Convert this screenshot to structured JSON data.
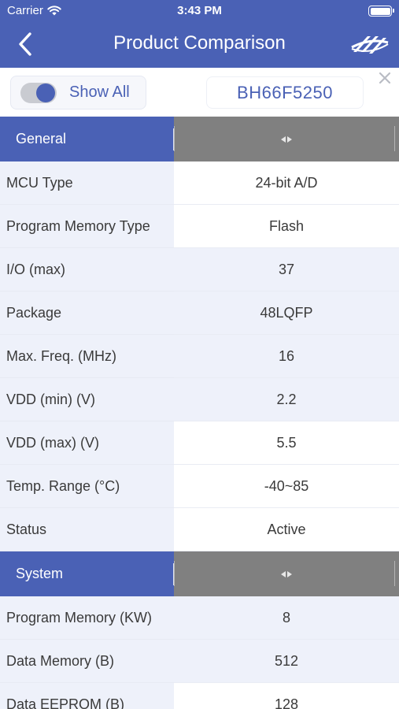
{
  "status_bar": {
    "carrier": "Carrier",
    "time": "3:43 PM"
  },
  "nav": {
    "title": "Product Comparison",
    "back_icon": "chevron-left-icon",
    "logo_icon": "company-logo-icon"
  },
  "controls": {
    "toggle_label": "Show All",
    "toggle_on": true,
    "product_name": "BH66F5250",
    "close_icon": "close-icon"
  },
  "colors": {
    "brand": "#4a61b5",
    "section_value_bg": "#808080",
    "row_alt_bg": "#eef1fa"
  },
  "sections": [
    {
      "title": "General",
      "rows": [
        {
          "label": "MCU Type",
          "value": "24-bit A/D"
        },
        {
          "label": "Program Memory Type",
          "value": "Flash"
        },
        {
          "label": "I/O (max)",
          "value": "37"
        },
        {
          "label": "Package",
          "value": "48LQFP"
        },
        {
          "label": "Max. Freq. (MHz)",
          "value": "16"
        },
        {
          "label": "VDD (min) (V)",
          "value": "2.2"
        },
        {
          "label": "VDD (max) (V)",
          "value": "5.5"
        },
        {
          "label": "Temp. Range (°C)",
          "value": "-40~85"
        },
        {
          "label": "Status",
          "value": "Active"
        }
      ]
    },
    {
      "title": "System",
      "rows": [
        {
          "label": "Program Memory (KW)",
          "value": "8"
        },
        {
          "label": "Data Memory (B)",
          "value": "512"
        },
        {
          "label": "Data EEPROM (B)",
          "value": "128"
        }
      ]
    }
  ]
}
